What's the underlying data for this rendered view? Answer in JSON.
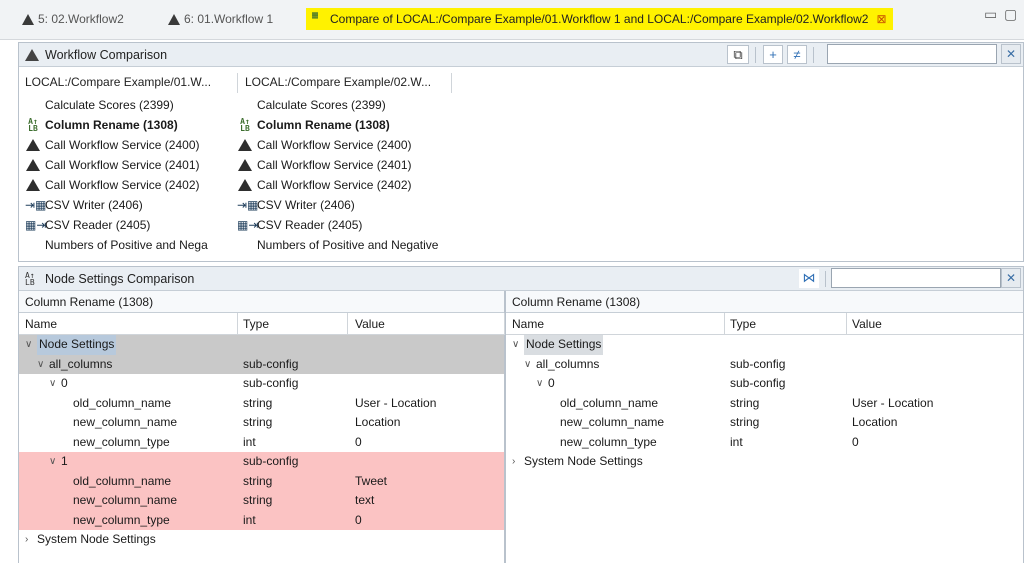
{
  "tabs": [
    {
      "label": "5: 02.Workflow2",
      "active": false
    },
    {
      "label": "6: 01.Workflow 1",
      "active": false
    },
    {
      "label": "Compare of LOCAL:/Compare Example/01.Workflow 1 and LOCAL:/Compare Example/02.Workflow2",
      "active": true
    }
  ],
  "workflow_comparison": {
    "title": "Workflow Comparison",
    "left_column": "LOCAL:/Compare Example/01.W...",
    "right_column": "LOCAL:/Compare Example/02.W...",
    "left_items": [
      {
        "label": "Calculate Scores (2399)",
        "icon": "none",
        "bold": false
      },
      {
        "label": "Column Rename (1308)",
        "icon": "column-rename-icon",
        "bold": true
      },
      {
        "label": "Call Workflow Service (2400)",
        "icon": "workflow-service-icon",
        "bold": false
      },
      {
        "label": "Call Workflow Service (2401)",
        "icon": "workflow-service-icon",
        "bold": false
      },
      {
        "label": "Call Workflow Service (2402)",
        "icon": "workflow-service-icon",
        "bold": false
      },
      {
        "label": "CSV Writer (2406)",
        "icon": "csv-writer-icon",
        "bold": false
      },
      {
        "label": "CSV Reader (2405)",
        "icon": "csv-reader-icon",
        "bold": false
      },
      {
        "label": "Numbers of Positive and Nega",
        "icon": "none",
        "bold": false
      }
    ],
    "right_items": [
      {
        "label": "Calculate Scores (2399)",
        "icon": "none",
        "bold": false
      },
      {
        "label": "Column Rename (1308)",
        "icon": "column-rename-icon",
        "bold": true
      },
      {
        "label": "Call Workflow Service (2400)",
        "icon": "workflow-service-icon",
        "bold": false
      },
      {
        "label": "Call Workflow Service (2401)",
        "icon": "workflow-service-icon",
        "bold": false
      },
      {
        "label": "Call Workflow Service (2402)",
        "icon": "workflow-service-icon",
        "bold": false
      },
      {
        "label": "CSV Writer (2406)",
        "icon": "csv-writer-icon",
        "bold": false
      },
      {
        "label": "CSV Reader (2405)",
        "icon": "csv-reader-icon",
        "bold": false
      },
      {
        "label": "Numbers of Positive and Negative",
        "icon": "none",
        "bold": false
      }
    ]
  },
  "node_settings": {
    "title": "Node Settings Comparison",
    "columns": {
      "name": "Name",
      "type": "Type",
      "value": "Value"
    },
    "left": {
      "heading": "Column Rename (1308)",
      "rows": [
        {
          "indent": 0,
          "chev": "v",
          "name": "Node Settings",
          "type": "",
          "value": "",
          "style": "gray",
          "label_style": "sel"
        },
        {
          "indent": 1,
          "chev": "v",
          "name": "all_columns",
          "type": "sub-config",
          "value": "",
          "style": "gray",
          "label_style": ""
        },
        {
          "indent": 2,
          "chev": "v",
          "name": "0",
          "type": "sub-config",
          "value": "",
          "style": "",
          "label_style": ""
        },
        {
          "indent": 4,
          "chev": "",
          "name": "old_column_name",
          "type": "string",
          "value": "User - Location",
          "style": "",
          "label_style": ""
        },
        {
          "indent": 4,
          "chev": "",
          "name": "new_column_name",
          "type": "string",
          "value": "Location",
          "style": "",
          "label_style": ""
        },
        {
          "indent": 4,
          "chev": "",
          "name": "new_column_type",
          "type": "int",
          "value": "0",
          "style": "",
          "label_style": ""
        },
        {
          "indent": 2,
          "chev": "v",
          "name": "1",
          "type": "sub-config",
          "value": "",
          "style": "pink",
          "label_style": ""
        },
        {
          "indent": 4,
          "chev": "",
          "name": "old_column_name",
          "type": "string",
          "value": "Tweet",
          "style": "pink",
          "label_style": ""
        },
        {
          "indent": 4,
          "chev": "",
          "name": "new_column_name",
          "type": "string",
          "value": "text",
          "style": "pink",
          "label_style": ""
        },
        {
          "indent": 4,
          "chev": "",
          "name": "new_column_type",
          "type": "int",
          "value": "0",
          "style": "pink",
          "label_style": ""
        },
        {
          "indent": 0,
          "chev": ">",
          "name": "System Node Settings",
          "type": "",
          "value": "",
          "style": "",
          "label_style": ""
        }
      ]
    },
    "right": {
      "heading": "Column Rename (1308)",
      "rows": [
        {
          "indent": 0,
          "chev": "v",
          "name": "Node Settings",
          "type": "",
          "value": "",
          "style": "",
          "label_style": "gray"
        },
        {
          "indent": 1,
          "chev": "v",
          "name": "all_columns",
          "type": "sub-config",
          "value": "",
          "style": "",
          "label_style": ""
        },
        {
          "indent": 2,
          "chev": "v",
          "name": "0",
          "type": "sub-config",
          "value": "",
          "style": "",
          "label_style": ""
        },
        {
          "indent": 4,
          "chev": "",
          "name": "old_column_name",
          "type": "string",
          "value": "User - Location",
          "style": "",
          "label_style": ""
        },
        {
          "indent": 4,
          "chev": "",
          "name": "new_column_name",
          "type": "string",
          "value": "Location",
          "style": "",
          "label_style": ""
        },
        {
          "indent": 4,
          "chev": "",
          "name": "new_column_type",
          "type": "int",
          "value": "0",
          "style": "",
          "label_style": ""
        },
        {
          "indent": 0,
          "chev": ">",
          "name": "System Node Settings",
          "type": "",
          "value": "",
          "style": "",
          "label_style": ""
        }
      ]
    }
  },
  "colors": {
    "active_tab": "#fff200",
    "added_row": "#fbc3c3",
    "selected_row": "#c9c9c9"
  }
}
